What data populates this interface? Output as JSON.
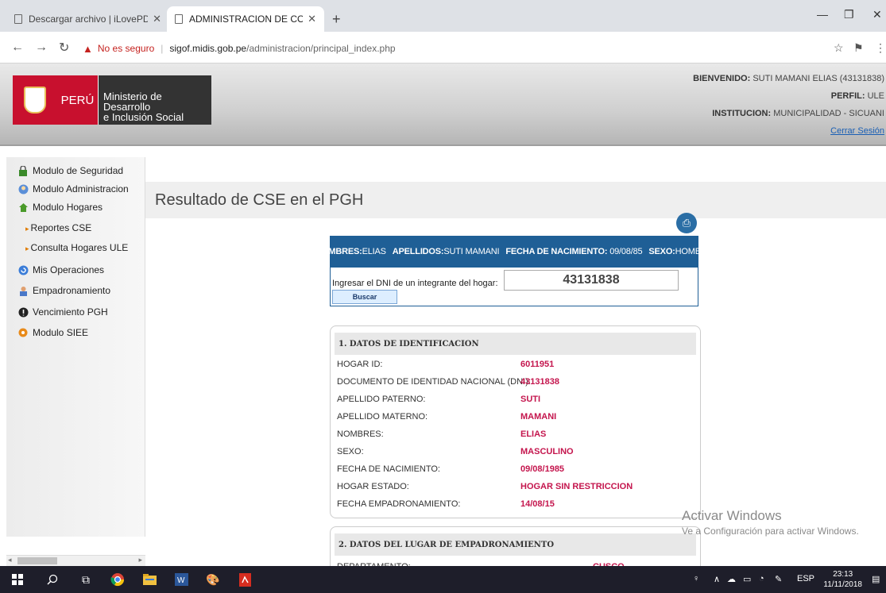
{
  "browser": {
    "tabs": [
      {
        "title": "Descargar archivo | iLovePDF",
        "active": false
      },
      {
        "title": "ADMINISTRACION DE CORREOS",
        "active": true
      }
    ],
    "security_label": "No es seguro",
    "url_host": "sigof.midis.gob.pe",
    "url_path": "/administracion/principal_index.php"
  },
  "header": {
    "peru": "PERÚ",
    "ministry_line1": "Ministerio de Desarrollo",
    "ministry_line2": "e Inclusión Social",
    "welcome_label": "BIENVENIDO:",
    "welcome_value": "SUTI MAMANI ELIAS (43131838)",
    "perfil_label": "PERFIL:",
    "perfil_value": "ULE",
    "institucion_label": "INSTITUCION:",
    "institucion_value": "MUNICIPALIDAD - SICUANI",
    "logout": "Cerrar Sesión"
  },
  "sidebar": {
    "items": [
      {
        "label": "Modulo de Seguridad",
        "icon": "lock-icon"
      },
      {
        "label": "Modulo Administracion",
        "icon": "admin-icon"
      },
      {
        "label": "Modulo Hogares",
        "icon": "house-icon"
      },
      {
        "label": "Reportes CSE",
        "icon": "arrow-icon"
      },
      {
        "label": "Consulta Hogares ULE",
        "icon": "arrow-icon"
      },
      {
        "label": "Mis Operaciones",
        "icon": "refresh-icon"
      },
      {
        "label": "Empadronamiento",
        "icon": "person-icon"
      },
      {
        "label": "Vencimiento PGH",
        "icon": "alert-icon"
      },
      {
        "label": "Modulo SIEE",
        "icon": "gear-icon"
      }
    ]
  },
  "main": {
    "title": "Resultado de CSE en el PGH",
    "infobar": {
      "nombres_label": "NOMBRES:",
      "nombres": "ELIAS",
      "apellidos_label": "APELLIDOS:",
      "apellidos": "SUTI MAMANI",
      "fecha_label": "FECHA DE NACIMIENTO:",
      "fecha": "09/08/85",
      "sexo_label": "SEXO:",
      "sexo": "HOMBRE"
    },
    "dni_label": "Ingresar el DNI de un integrante del hogar:",
    "dni_value": "43131838",
    "search_button": "Buscar",
    "section1": {
      "title": "1. DATOS DE IDENTIFICACION",
      "rows": [
        {
          "label": "HOGAR ID:",
          "value": "6011951"
        },
        {
          "label": "DOCUMENTO DE IDENTIDAD NACIONAL (DNI):",
          "value": "43131838"
        },
        {
          "label": "APELLIDO PATERNO:",
          "value": "SUTI"
        },
        {
          "label": "APELLIDO MATERNO:",
          "value": "MAMANI"
        },
        {
          "label": "NOMBRES:",
          "value": "ELIAS"
        },
        {
          "label": "SEXO:",
          "value": "MASCULINO"
        },
        {
          "label": "FECHA DE NACIMIENTO:",
          "value": "09/08/1985"
        },
        {
          "label": "HOGAR ESTADO:",
          "value": "HOGAR SIN RESTRICCION"
        },
        {
          "label": "FECHA EMPADRONAMIENTO:",
          "value": "14/08/15"
        }
      ]
    },
    "section2": {
      "title": "2. DATOS DEL LUGAR DE EMPADRONAMIENTO",
      "rows": [
        {
          "label": "DEPARTAMENTO:",
          "value": "CUSCO"
        }
      ]
    }
  },
  "watermark": {
    "line1": "Activar Windows",
    "line2": "Ve a Configuración para activar Windows."
  },
  "taskbar": {
    "lang": "ESP",
    "time": "23:13",
    "date": "11/11/2018"
  }
}
